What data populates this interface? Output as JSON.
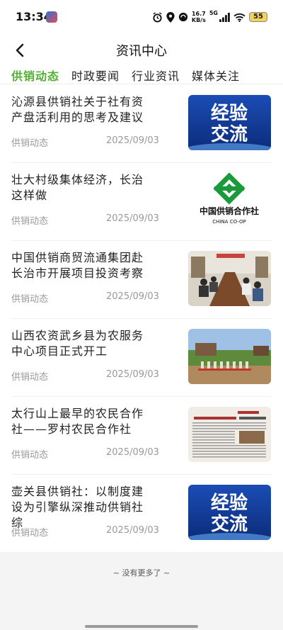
{
  "status_bar": {
    "time": "13:34",
    "net_speed_value": "16.7",
    "net_speed_unit": "KB/s",
    "signal_label": "5G",
    "battery_level": "55"
  },
  "header": {
    "title": "资讯中心",
    "back_icon": "chevron-left-icon"
  },
  "tabs": [
    {
      "label": "供销动态",
      "active": true
    },
    {
      "label": "时政要闻",
      "active": false
    },
    {
      "label": "行业资讯",
      "active": false
    },
    {
      "label": "媒体关注",
      "active": false
    }
  ],
  "articles": [
    {
      "title": "沁源县供销社关于社有资产盘活利用的思考及建议",
      "source": "供销动态",
      "date": "2025/09/03",
      "thumbnail_text": [
        "经验",
        "交流"
      ]
    },
    {
      "title": "壮大村级集体经济，长治这样做",
      "source": "供销动态",
      "date": "2025/09/03",
      "thumbnail_text": [
        "中国供销合作社",
        "CHINA CO-OP"
      ]
    },
    {
      "title": "中国供销商贸流通集团赴长治市开展项目投资考察",
      "source": "供销动态",
      "date": "2025/09/03"
    },
    {
      "title": "山西农资武乡县为农服务中心项目正式开工",
      "source": "供销动态",
      "date": "2025/09/03"
    },
    {
      "title": "太行山上最早的农民合作社——罗村农民合作社",
      "source": "供销动态",
      "date": "2025/09/03"
    },
    {
      "title": "壶关县供销社：以制度建设为引擎纵深推动供销社综",
      "source": "供销动态",
      "date": "2025/09/03",
      "thumbnail_text": [
        "经验",
        "交流"
      ]
    }
  ],
  "footer": {
    "no_more": "~ 没有更多了 ~"
  },
  "colors": {
    "accent": "#52b035",
    "thumb_blue": "#1d4fb5"
  }
}
